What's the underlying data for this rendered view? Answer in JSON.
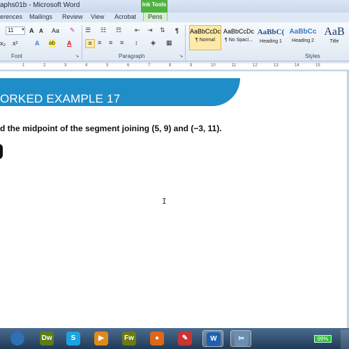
{
  "window": {
    "title": "aphs01b - Microsoft Word",
    "ink_tools_label": "Ink Tools"
  },
  "tabs": [
    "erences",
    "Mailings",
    "Review",
    "View",
    "Acrobat",
    "Pens"
  ],
  "ribbon": {
    "font_size": "11",
    "font_group_label": "Font",
    "paragraph_group_label": "Paragraph",
    "styles_group_label": "Styles",
    "styles": [
      {
        "preview": "AaBbCcDc",
        "name": "¶ Normal",
        "selected": true
      },
      {
        "preview": "AaBbCcDc",
        "name": "¶ No Spaci...",
        "selected": false
      },
      {
        "preview": "AaBbC(",
        "name": "Heading 1",
        "selected": false
      },
      {
        "preview": "AaBbCc",
        "name": "Heading 2",
        "selected": false
      },
      {
        "preview": "AaB",
        "name": "Title",
        "selected": false
      }
    ],
    "buttons": {
      "grow": "A",
      "shrink": "A",
      "case": "Aa",
      "subscript": "x₂",
      "superscript": "x²",
      "text_effects": "A",
      "highlight": "ab",
      "font_color": "A",
      "pilcrow": "¶"
    }
  },
  "ruler": {
    "numbers": [
      "1",
      "2",
      "3",
      "4",
      "5",
      "6",
      "7",
      "8",
      "9",
      "10",
      "11",
      "12",
      "13",
      "14",
      "15"
    ]
  },
  "document": {
    "banner_title": "ORKED EXAMPLE 17",
    "question": "d the midpoint of the segment joining (5, 9) and (−3, 11)."
  },
  "taskbar": {
    "apps": [
      {
        "name": "start-orb",
        "label": "",
        "color": "#2f6fb3",
        "active": false
      },
      {
        "name": "dreamweaver",
        "label": "Dw",
        "color": "#5b7d1a",
        "active": false
      },
      {
        "name": "skype",
        "label": "S",
        "color": "#1aa3e0",
        "active": false
      },
      {
        "name": "media-player",
        "label": "▶",
        "color": "#e08a1a",
        "active": false
      },
      {
        "name": "fireworks",
        "label": "Fw",
        "color": "#6c7a10",
        "active": false
      },
      {
        "name": "firefox",
        "label": "●",
        "color": "#e0661a",
        "active": false
      },
      {
        "name": "paint",
        "label": "✎",
        "color": "#c33",
        "active": false
      },
      {
        "name": "word",
        "label": "W",
        "color": "#1f5fb0",
        "active": true
      },
      {
        "name": "snipping",
        "label": "✂",
        "color": "#6a8fb5",
        "active": true
      }
    ],
    "battery": "99%"
  },
  "colors": {
    "banner": "#1f8dc8",
    "ink_tools": "#4fb240",
    "battery": "#2fbd32"
  }
}
